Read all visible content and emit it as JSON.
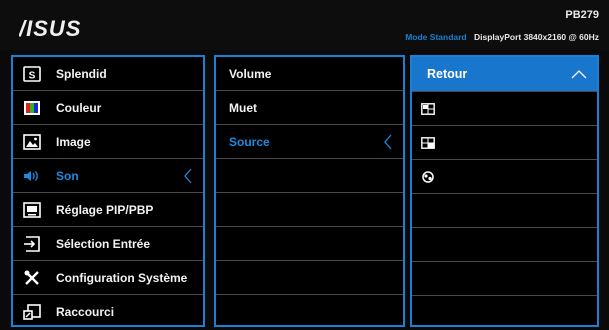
{
  "header": {
    "brand": "ASUS",
    "model": "PB279",
    "mode": "Mode Standard",
    "port": "DisplayPort  3840x2160 @ 60Hz"
  },
  "menu": {
    "items": [
      {
        "label": "Splendid",
        "icon": "splendid-icon"
      },
      {
        "label": "Couleur",
        "icon": "color-icon"
      },
      {
        "label": "Image",
        "icon": "image-icon"
      },
      {
        "label": "Son",
        "icon": "speaker-icon",
        "active": true
      },
      {
        "label": "Réglage PIP/PBP",
        "icon": "pip-icon"
      },
      {
        "label": "Sélection Entrée",
        "icon": "input-icon"
      },
      {
        "label": "Configuration Système",
        "icon": "tools-icon"
      },
      {
        "label": "Raccourci",
        "icon": "shortcut-icon"
      }
    ]
  },
  "submenu": {
    "items": [
      {
        "label": "Volume"
      },
      {
        "label": "Muet"
      },
      {
        "label": "Source",
        "active": true
      },
      {
        "label": ""
      },
      {
        "label": ""
      },
      {
        "label": ""
      },
      {
        "label": ""
      },
      {
        "label": ""
      }
    ]
  },
  "options": {
    "back_label": "Retour",
    "items": [
      {
        "icon": "pip-source-1-icon"
      },
      {
        "icon": "pip-source-2-icon"
      },
      {
        "icon": "pip-source-3-icon"
      }
    ]
  },
  "colors": {
    "accent": "#1c7fd6",
    "selected_bg": "#1876cc",
    "active_text": "#1c8ae0"
  }
}
